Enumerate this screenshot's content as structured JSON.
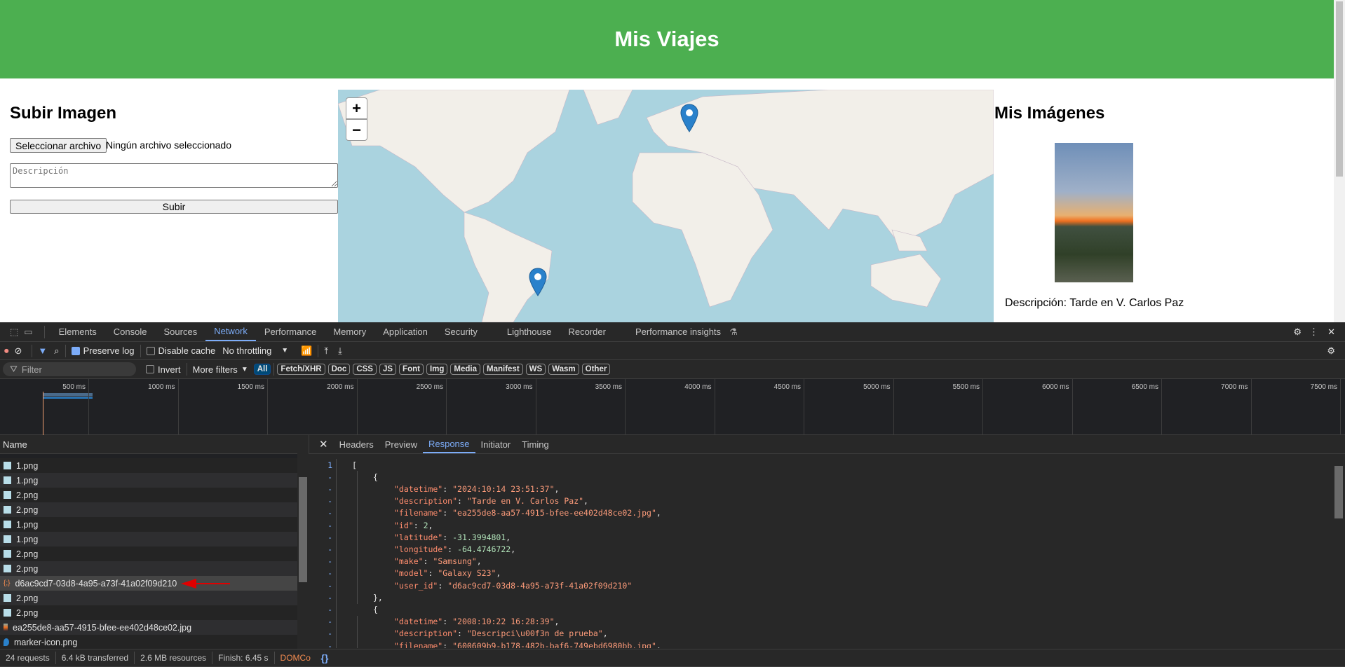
{
  "page": {
    "title": "Mis Viajes",
    "upload": {
      "heading": "Subir Imagen",
      "file_button": "Seleccionar archivo",
      "file_status": "Ningún archivo seleccionado",
      "description_placeholder": "Descripción",
      "submit": "Subir"
    },
    "map": {
      "zoom_in": "+",
      "zoom_out": "−",
      "markers": [
        {
          "name": "Europe marker"
        },
        {
          "name": "Argentina marker"
        }
      ]
    },
    "images": {
      "heading": "Mis Imágenes",
      "items": [
        {
          "description": "Descripción: Tarde en V. Carlos Paz"
        }
      ]
    }
  },
  "devtools": {
    "tabs": [
      "Elements",
      "Console",
      "Sources",
      "Network",
      "Performance",
      "Memory",
      "Application",
      "Security",
      "Lighthouse",
      "Recorder",
      "Performance insights"
    ],
    "active_tab": "Network",
    "toolbar": {
      "preserve_log": "Preserve log",
      "disable_cache": "Disable cache",
      "throttling": "No throttling"
    },
    "filter": {
      "placeholder": "Filter",
      "invert": "Invert",
      "more_filters": "More filters",
      "types": [
        "All",
        "Fetch/XHR",
        "Doc",
        "CSS",
        "JS",
        "Font",
        "Img",
        "Media",
        "Manifest",
        "WS",
        "Wasm",
        "Other"
      ]
    },
    "timeline": [
      "500 ms",
      "1000 ms",
      "1500 ms",
      "2000 ms",
      "2500 ms",
      "3000 ms",
      "3500 ms",
      "4000 ms",
      "4500 ms",
      "5000 ms",
      "5500 ms",
      "6000 ms",
      "6500 ms",
      "7000 ms",
      "7500 ms"
    ],
    "requests": {
      "header": "Name",
      "rows": [
        "1.png",
        "1.png",
        "2.png",
        "2.png",
        "1.png",
        "1.png",
        "2.png",
        "2.png",
        "d6ac9cd7-03d8-4a95-a73f-41a02f09d210",
        "2.png",
        "2.png",
        "ea255de8-aa57-4915-bfee-ee402d48ce02.jpg",
        "marker-icon.png"
      ]
    },
    "detail_tabs": [
      "Headers",
      "Preview",
      "Response",
      "Initiator",
      "Timing"
    ],
    "active_detail_tab": "Response",
    "response_lines": [
      {
        "ln": "1",
        "indent": 0,
        "text": "["
      },
      {
        "ln": "-",
        "indent": 1,
        "text": "{"
      },
      {
        "ln": "-",
        "indent": 2,
        "key": "\"datetime\"",
        "val": "\"2024:10:14 23:51:37\"",
        "cls": "s",
        "end": ","
      },
      {
        "ln": "-",
        "indent": 2,
        "key": "\"description\"",
        "val": "\"Tarde en V. Carlos Paz\"",
        "cls": "s",
        "end": ","
      },
      {
        "ln": "-",
        "indent": 2,
        "key": "\"filename\"",
        "val": "\"ea255de8-aa57-4915-bfee-ee402d48ce02.jpg\"",
        "cls": "s",
        "end": ","
      },
      {
        "ln": "-",
        "indent": 2,
        "key": "\"id\"",
        "val": "2",
        "cls": "n",
        "end": ","
      },
      {
        "ln": "-",
        "indent": 2,
        "key": "\"latitude\"",
        "val": "-31.3994801",
        "cls": "n",
        "end": ","
      },
      {
        "ln": "-",
        "indent": 2,
        "key": "\"longitude\"",
        "val": "-64.4746722",
        "cls": "n",
        "end": ","
      },
      {
        "ln": "-",
        "indent": 2,
        "key": "\"make\"",
        "val": "\"Samsung\"",
        "cls": "s",
        "end": ","
      },
      {
        "ln": "-",
        "indent": 2,
        "key": "\"model\"",
        "val": "\"Galaxy S23\"",
        "cls": "s",
        "end": ","
      },
      {
        "ln": "-",
        "indent": 2,
        "key": "\"user_id\"",
        "val": "\"d6ac9cd7-03d8-4a95-a73f-41a02f09d210\"",
        "cls": "s",
        "end": ""
      },
      {
        "ln": "-",
        "indent": 1,
        "text": "},"
      },
      {
        "ln": "-",
        "indent": 1,
        "text": "{"
      },
      {
        "ln": "-",
        "indent": 2,
        "key": "\"datetime\"",
        "val": "\"2008:10:22 16:28:39\"",
        "cls": "s",
        "end": ","
      },
      {
        "ln": "-",
        "indent": 2,
        "key": "\"description\"",
        "val": "\"Descripci\\u00f3n de prueba\"",
        "cls": "s",
        "end": ","
      },
      {
        "ln": "-",
        "indent": 2,
        "key": "\"filename\"",
        "val": "\"600609b9-b178-482b-baf6-749ebd6980bb.jpg\"",
        "cls": "s",
        "end": ","
      }
    ],
    "status": {
      "requests": "24 requests",
      "transferred": "6.4 kB transferred",
      "resources": "2.6 MB resources",
      "finish": "Finish: 6.45 s",
      "domcontent": "DOMCo"
    },
    "colors": {
      "header": "#4caf50",
      "accent": "#7cacf8",
      "arrow": "#e00000"
    }
  }
}
